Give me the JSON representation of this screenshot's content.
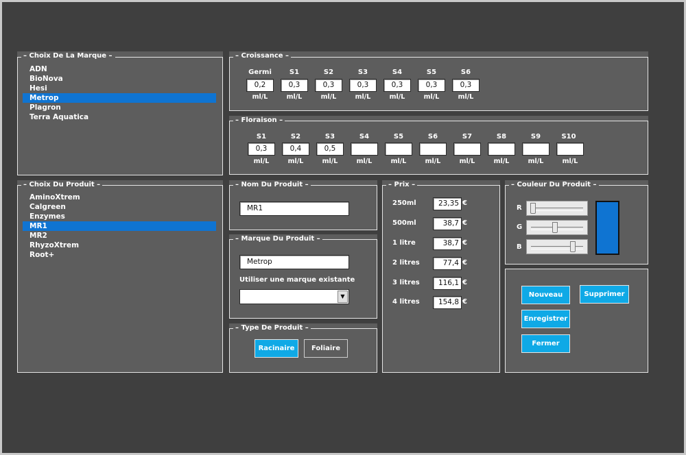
{
  "brand_panel": {
    "title": "Choix De La Marque",
    "items": [
      "ADN",
      "BioNova",
      "Hesi",
      "Metrop",
      "Plagron",
      "Terra Aquatica"
    ],
    "selected": "Metrop"
  },
  "product_panel": {
    "title": "Choix Du Produit",
    "items": [
      "AminoXtrem",
      "Calgreen",
      "Enzymes",
      "MR1",
      "MR2",
      "RhyzoXtrem",
      "Root+"
    ],
    "selected": "MR1"
  },
  "croissance": {
    "title": "Croissance",
    "columns": [
      {
        "label": "Germi",
        "value": "0,2",
        "unit": "ml/L"
      },
      {
        "label": "S1",
        "value": "0,3",
        "unit": "ml/L"
      },
      {
        "label": "S2",
        "value": "0,3",
        "unit": "ml/L"
      },
      {
        "label": "S3",
        "value": "0,3",
        "unit": "ml/L"
      },
      {
        "label": "S4",
        "value": "0,3",
        "unit": "ml/L"
      },
      {
        "label": "S5",
        "value": "0,3",
        "unit": "ml/L"
      },
      {
        "label": "S6",
        "value": "0,3",
        "unit": "ml/L"
      }
    ]
  },
  "floraison": {
    "title": "Floraison",
    "columns": [
      {
        "label": "S1",
        "value": "0,3",
        "unit": "ml/L"
      },
      {
        "label": "S2",
        "value": "0,4",
        "unit": "ml/L"
      },
      {
        "label": "S3",
        "value": "0,5",
        "unit": "ml/L"
      },
      {
        "label": "S4",
        "value": "",
        "unit": "ml/L"
      },
      {
        "label": "S5",
        "value": "",
        "unit": "ml/L"
      },
      {
        "label": "S6",
        "value": "",
        "unit": "ml/L"
      },
      {
        "label": "S7",
        "value": "",
        "unit": "ml/L"
      },
      {
        "label": "S8",
        "value": "",
        "unit": "ml/L"
      },
      {
        "label": "S9",
        "value": "",
        "unit": "ml/L"
      },
      {
        "label": "S10",
        "value": "",
        "unit": "ml/L"
      }
    ]
  },
  "nom_produit": {
    "title": "Nom Du Produit",
    "value": "MR1"
  },
  "marque_produit": {
    "title": "Marque Du Produit",
    "value": "Metrop",
    "existing_label": "Utiliser une marque existante",
    "existing_selected": ""
  },
  "type_produit": {
    "title": "Type De Produit",
    "options": [
      "Racinaire",
      "Foliaire"
    ],
    "selected": "Racinaire"
  },
  "prix": {
    "title": "Prix",
    "currency": "€",
    "rows": [
      {
        "label": "250ml",
        "value": "23,35"
      },
      {
        "label": "500ml",
        "value": "38,7"
      },
      {
        "label": "1 litre",
        "value": "38,7"
      },
      {
        "label": "2 litres",
        "value": "77,4"
      },
      {
        "label": "3 litres",
        "value": "116,1"
      },
      {
        "label": "4 litres",
        "value": "154,8"
      }
    ]
  },
  "couleur": {
    "title": "Couleur Du Produit",
    "channels": [
      {
        "label": "R",
        "level": 0.0
      },
      {
        "label": "G",
        "level": 0.46
      },
      {
        "label": "B",
        "level": 0.83
      }
    ],
    "swatch_color": "#0f74d2"
  },
  "actions": {
    "nouveau": "Nouveau",
    "supprimer": "Supprimer",
    "enregistrer": "Enregistrer",
    "fermer": "Fermer"
  },
  "colors": {
    "accent_button": "#0fa9e6",
    "selection": "#0f74d2",
    "panel_bg": "#5d5d5d",
    "window_bg": "#3f3f3f"
  }
}
